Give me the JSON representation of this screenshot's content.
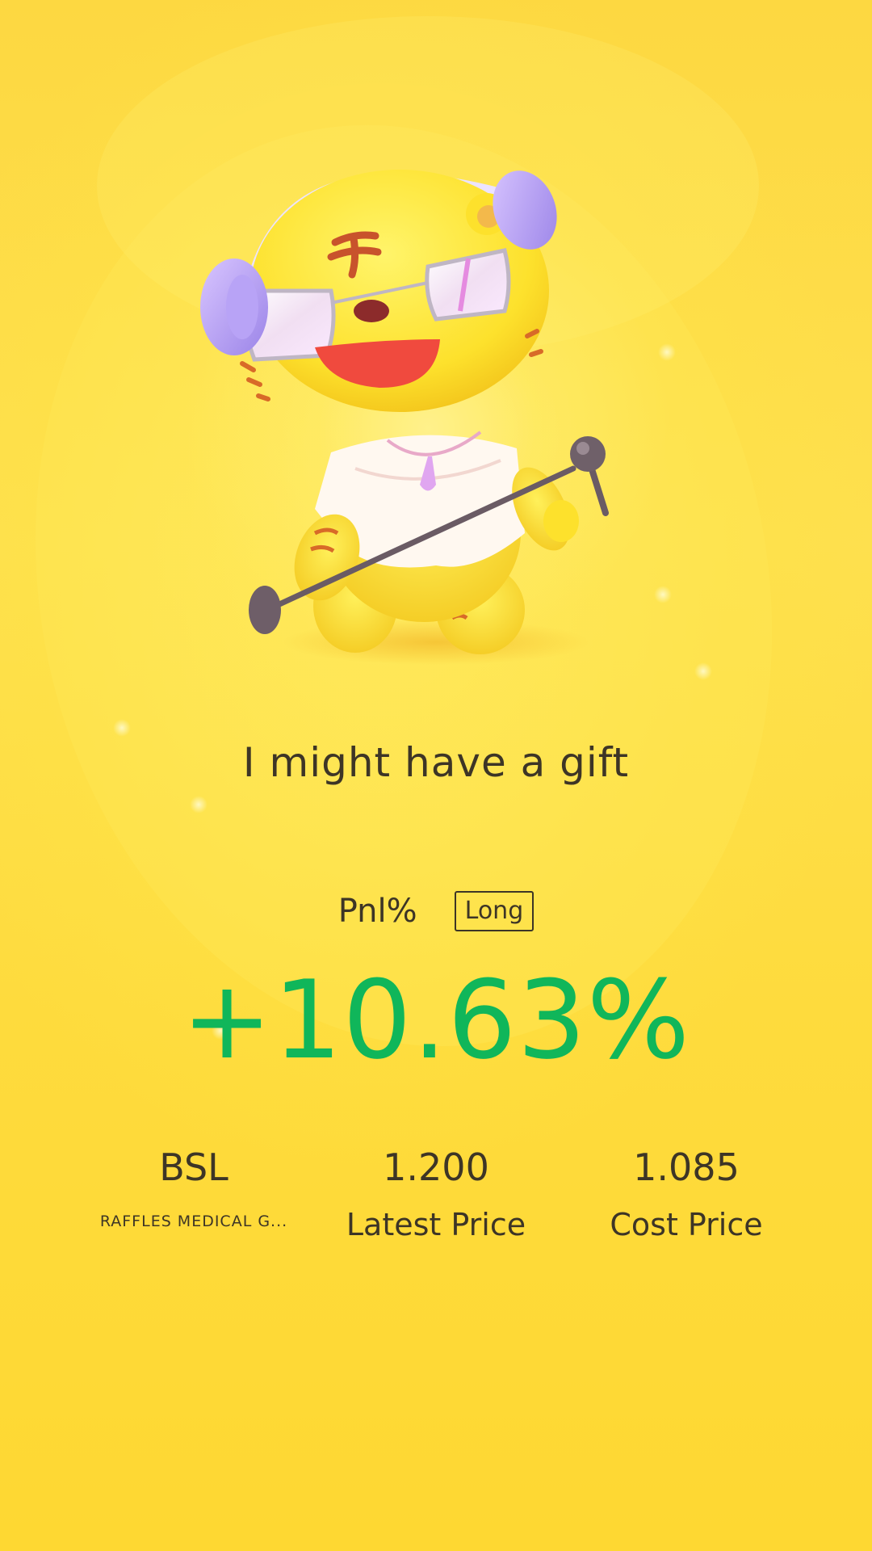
{
  "headline": "I might have a gift",
  "pnl": {
    "label": "Pnl%",
    "position_badge": "Long",
    "value": "+10.63%",
    "value_color": "#10b65a"
  },
  "stock": {
    "symbol": "BSL",
    "name": "RAFFLES MEDICAL G..."
  },
  "latest_price": {
    "value": "1.200",
    "label": "Latest Price"
  },
  "cost_price": {
    "value": "1.085",
    "label": "Cost Price"
  },
  "colors": {
    "background": "#fdd934",
    "text": "#3d3526",
    "gain": "#10b65a"
  },
  "icons": {
    "mascot": "tiger-mascot-with-headphones-and-microphone"
  }
}
